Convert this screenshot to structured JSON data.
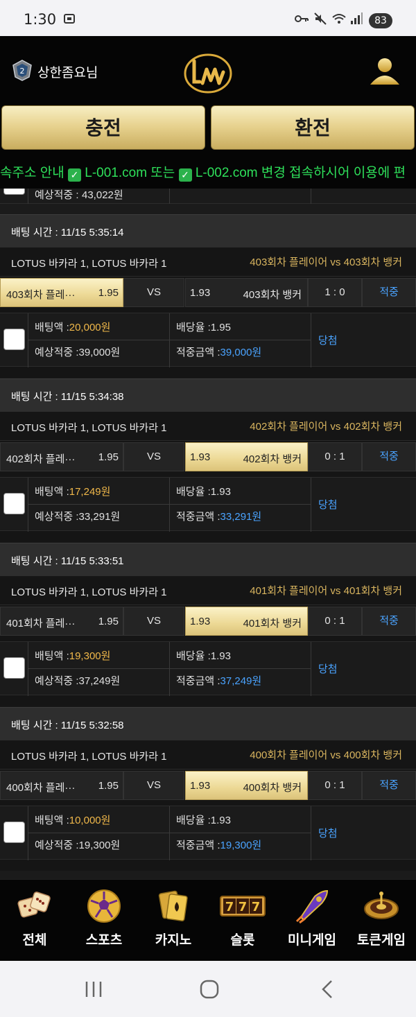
{
  "status_bar": {
    "time": "1:30",
    "battery": "83"
  },
  "header": {
    "username": "상한좀요님"
  },
  "actions": {
    "charge": "충전",
    "exchange": "환전"
  },
  "ticker": {
    "part1": "속주소 안내",
    "part2": "L-001.com 또는",
    "part3": "L-002.com 변경 접속하시어 이용에 편"
  },
  "partial_card": {
    "expected_label": "예상적중 :",
    "expected_value": "43,022원"
  },
  "labels": {
    "bet_time": "배팅 시간 :",
    "vs": "VS",
    "bet_amount": "배팅액 :",
    "odds_rate": "배당율 :",
    "expected": "예상적중 :",
    "win_amount": "적중금액 :"
  },
  "bets": [
    {
      "time": "11/15 5:35:14",
      "league": "LOTUS 바카라 1, LOTUS 바카라 1",
      "match": "403회차 플레이어  vs  403회차 뱅커",
      "home": "403회차 플레···",
      "home_odds": "1.95",
      "away": "403회차 뱅커",
      "away_odds": "1.93",
      "selected": "home",
      "score": "1 : 0",
      "result": "적중",
      "amount": "20,000원",
      "rate": "1.95",
      "expected": "39,000원",
      "win_amount": "39,000원",
      "status": "당첨"
    },
    {
      "time": "11/15 5:34:38",
      "league": "LOTUS 바카라 1, LOTUS 바카라 1",
      "match": "402회차 플레이어  vs  402회차 뱅커",
      "home": "402회차 플레···",
      "home_odds": "1.95",
      "away": "402회차 뱅커",
      "away_odds": "1.93",
      "selected": "away",
      "score": "0 : 1",
      "result": "적중",
      "amount": "17,249원",
      "rate": "1.93",
      "expected": "33,291원",
      "win_amount": "33,291원",
      "status": "당첨"
    },
    {
      "time": "11/15 5:33:51",
      "league": "LOTUS 바카라 1, LOTUS 바카라 1",
      "match": "401회차 플레이어  vs  401회차 뱅커",
      "home": "401회차 플레···",
      "home_odds": "1.95",
      "away": "401회차 뱅커",
      "away_odds": "1.93",
      "selected": "away",
      "score": "0 : 1",
      "result": "적중",
      "amount": "19,300원",
      "rate": "1.93",
      "expected": "37,249원",
      "win_amount": "37,249원",
      "status": "당첨"
    },
    {
      "time": "11/15 5:32:58",
      "league": "LOTUS 바카라 1, LOTUS 바카라 1",
      "match": "400회차 플레이어  vs  400회차 뱅커",
      "home": "400회차 플레···",
      "home_odds": "1.95",
      "away": "400회차 뱅커",
      "away_odds": "1.93",
      "selected": "away",
      "score": "0 : 1",
      "result": "적중",
      "amount": "10,000원",
      "rate": "1.93",
      "expected": "19,300원",
      "win_amount": "19,300원",
      "status": "당첨"
    }
  ],
  "bottom_nav": [
    {
      "label": "전체",
      "icon": "dice-icon"
    },
    {
      "label": "스포츠",
      "icon": "soccer-ball-icon"
    },
    {
      "label": "카지노",
      "icon": "cards-icon"
    },
    {
      "label": "슬롯",
      "icon": "slot-777-icon"
    },
    {
      "label": "미니게임",
      "icon": "rocket-icon"
    },
    {
      "label": "토큰게임",
      "icon": "roulette-icon"
    }
  ],
  "colors": {
    "gold_button": "#e8d390",
    "ticker_green": "#2ee05a",
    "win_blue": "#4aa3ff",
    "amount_gold": "#f0b84a",
    "match_gold": "#d9b55f"
  }
}
